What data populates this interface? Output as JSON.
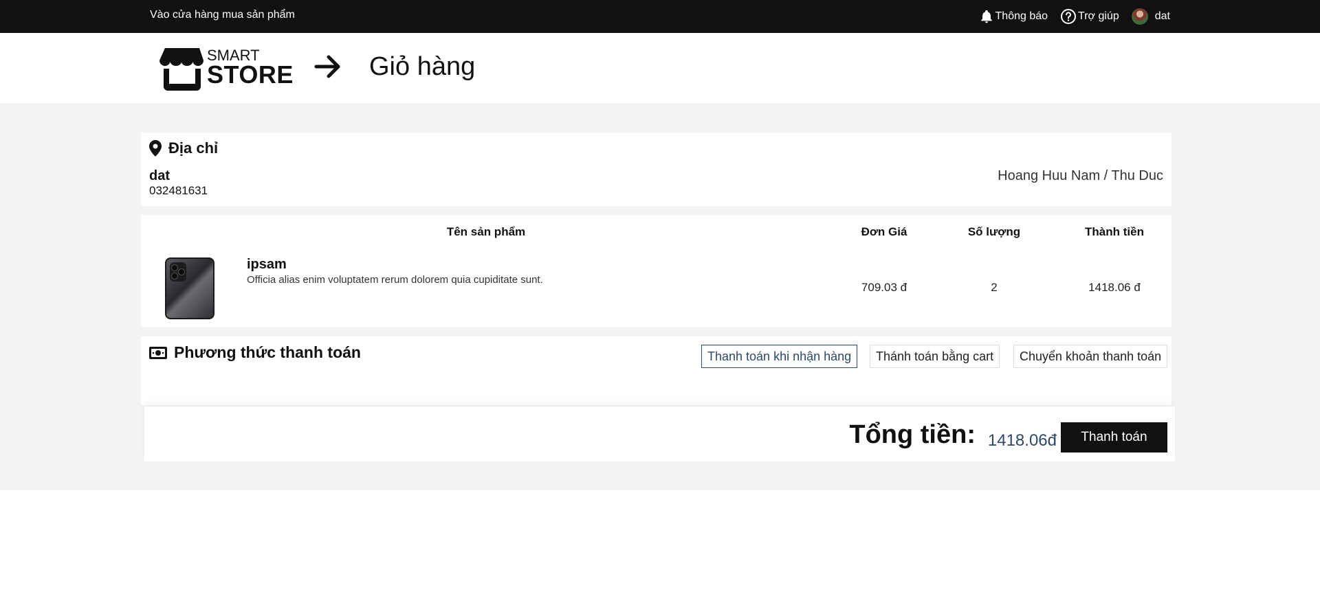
{
  "topbar": {
    "shop_link": "Vào cửa hàng mua sản phẩm",
    "notifications_label": "Thông báo",
    "help_label": "Trợ giúp",
    "username": "dat"
  },
  "header": {
    "logo_top": "SMART",
    "logo_bottom": "STORE",
    "page_title": "Giỏ hàng"
  },
  "address": {
    "heading": "Địa chỉ",
    "name": "dat",
    "phone": "032481631",
    "location": "Hoang Huu Nam / Thu Duc"
  },
  "cart": {
    "columns": {
      "product": "Tên sản phẩm",
      "unit_price": "Đơn Giá",
      "quantity": "Số lượng",
      "subtotal": "Thành tiền"
    },
    "items": [
      {
        "name": "ipsam",
        "description": "Officia alias enim voluptatem rerum dolorem quia cupiditate sunt.",
        "unit_price": "709.03 đ",
        "quantity": "2",
        "subtotal": "1418.06 đ"
      }
    ]
  },
  "payment": {
    "heading": "Phương thức thanh toán",
    "options": [
      {
        "label": "Thanh toán khi nhận hàng",
        "selected": true
      },
      {
        "label": "Thánh toán bằng cart",
        "selected": false
      },
      {
        "label": "Chuyển khoản thanh toán",
        "selected": false
      }
    ]
  },
  "summary": {
    "total_label": "Tổng tiền:",
    "total_value": "1418.06đ",
    "checkout_label": "Thanh toán"
  },
  "colors": {
    "topbar_bg": "#111111",
    "accent": "#2c4a66",
    "page_bg": "#f4f4f4"
  }
}
